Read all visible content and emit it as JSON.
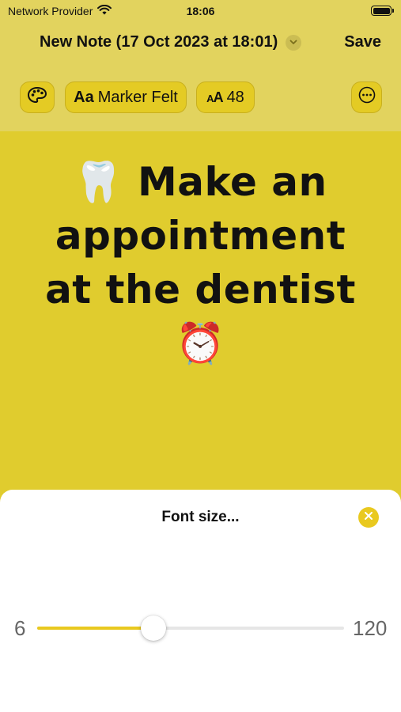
{
  "status_bar": {
    "carrier": "Network Provider",
    "time": "18:06",
    "wifi_icon": "wifi-icon",
    "battery_icon": "battery-icon"
  },
  "nav": {
    "title": "New Note (17 Oct 2023 at 18:01)",
    "title_menu_icon": "chevron-down-icon",
    "save_label": "Save"
  },
  "toolbar": {
    "palette_icon": "palette-icon",
    "font_glyph": "Aa",
    "font_name": "Marker Felt",
    "size_glyph": "AA",
    "font_size": "48",
    "more_icon": "ellipsis-circle-icon"
  },
  "note": {
    "text": "🦷 Make an appointment at the dentist ⏰"
  },
  "sheet": {
    "title": "Font size...",
    "close_icon": "close-icon",
    "slider_min": "6",
    "slider_max": "120",
    "slider_fraction": 0.38
  },
  "colors": {
    "accent": "#e9c91f",
    "note_background": "#e0cc2e",
    "toolbar_background": "#e2d35e"
  }
}
